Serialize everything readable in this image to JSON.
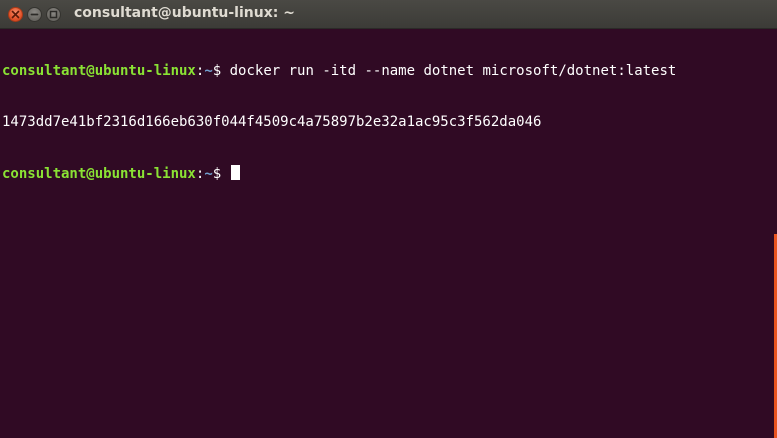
{
  "window": {
    "title": "consultant@ubuntu-linux: ~"
  },
  "colors": {
    "background": "#300a24",
    "prompt_user": "#8ae234",
    "prompt_path": "#729fcf",
    "close_button": "#e3532a",
    "scroll_accent": "#e95420"
  },
  "icons": {
    "close": "close-icon",
    "minimize": "minimize-icon",
    "maximize": "maximize-icon"
  },
  "terminal": {
    "lines": [
      {
        "prompt_user": "consultant@ubuntu-linux",
        "prompt_colon": ":",
        "prompt_path": "~",
        "prompt_dollar": "$ ",
        "command": "docker run -itd --name dotnet microsoft/dotnet:latest"
      },
      {
        "output": "1473dd7e41bf2316d166eb630f044f4509c4a75897b2e32a1ac95c3f562da046"
      },
      {
        "prompt_user": "consultant@ubuntu-linux",
        "prompt_colon": ":",
        "prompt_path": "~",
        "prompt_dollar": "$ ",
        "command": ""
      }
    ]
  }
}
